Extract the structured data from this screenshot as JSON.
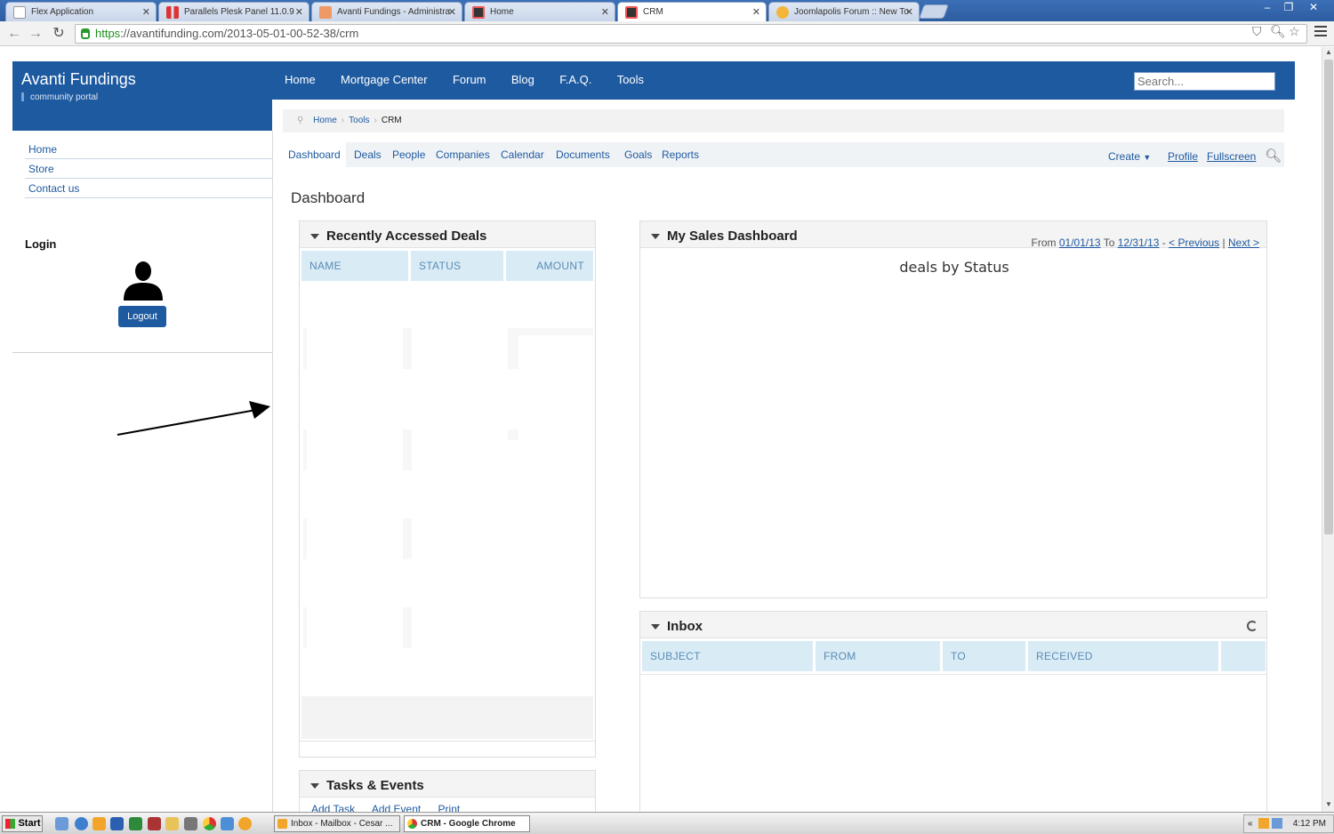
{
  "browser": {
    "tabs": [
      {
        "label": "Flex Application"
      },
      {
        "label": "Parallels Plesk Panel 11.0.9"
      },
      {
        "label": "Avanti Fundings - Administra"
      },
      {
        "label": "Home"
      },
      {
        "label": "CRM"
      },
      {
        "label": "Joomlapolis Forum :: New To"
      }
    ],
    "url_scheme": "https",
    "url_rest": "://avantifunding.com/2013-05-01-00-52-38/crm"
  },
  "site": {
    "brand": "Avanti Fundings",
    "tagline": "community portal",
    "nav": [
      "Home",
      "Mortgage Center",
      "Forum",
      "Blog",
      "F.A.Q.",
      "Tools"
    ],
    "search_placeholder": "Search..."
  },
  "sidebar": {
    "menu": [
      "Home",
      "Store",
      "Contact us"
    ],
    "login_title": "Login",
    "logout_label": "Logout"
  },
  "breadcrumb": {
    "home": "Home",
    "tools": "Tools",
    "current": "CRM"
  },
  "crm_tabs": [
    "Dashboard",
    "Deals",
    "People",
    "Companies",
    "Calendar",
    "Documents",
    "Goals",
    "Reports"
  ],
  "crm_actions": {
    "create": "Create",
    "profile": "Profile",
    "fullscreen": "Fullscreen"
  },
  "page_title": "Dashboard",
  "deals_panel": {
    "title": "Recently Accessed Deals",
    "columns": [
      "NAME",
      "STATUS",
      "AMOUNT"
    ]
  },
  "sales_panel": {
    "title": "My Sales Dashboard",
    "from_label": "From",
    "from_date": "01/01/13",
    "to_label": "To",
    "to_date": "12/31/13",
    "dash": "-",
    "previous": "< Previous",
    "sep": "|",
    "next": "Next >",
    "chart_title": "deals by Status"
  },
  "inbox_panel": {
    "title": "Inbox",
    "columns": [
      "SUBJECT",
      "FROM",
      "TO",
      "RECEIVED"
    ]
  },
  "tasks_panel": {
    "title": "Tasks & Events",
    "links": [
      "Add Task",
      "Add Event",
      "Print"
    ]
  },
  "taskbar": {
    "start": "Start",
    "tasks": [
      "Inbox - Mailbox - Cesar ...",
      "CRM - Google Chrome"
    ],
    "clock": "4:12 PM"
  },
  "colors": {
    "brand_blue": "#1e5aa0",
    "table_header": "#d9ecf6"
  }
}
